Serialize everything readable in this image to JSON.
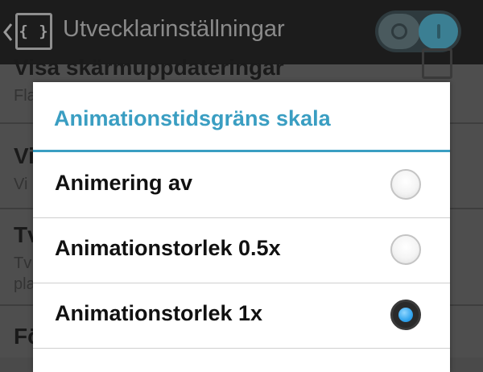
{
  "actionbar": {
    "icon_glyph": "{ }",
    "title": "Utvecklarinställningar",
    "toggle_state": "on"
  },
  "settings": {
    "items": [
      {
        "title": "Visa skärmuppdateringar",
        "summary": "Fla"
      },
      {
        "title": "Vi",
        "summary": "Vi"
      },
      {
        "title": "Tv",
        "summary_line1": "Tv",
        "summary_line2": "pla"
      },
      {
        "title": "Fö"
      }
    ]
  },
  "dialog": {
    "title": "Animationstidsgräns skala",
    "options": [
      {
        "label": "Animering av",
        "selected": false
      },
      {
        "label": "Animationstorlek 0.5x",
        "selected": false
      },
      {
        "label": "Animationstorlek 1x",
        "selected": true
      }
    ]
  },
  "colors": {
    "accent": "#3a9ec2",
    "actionbar_bg": "#1c1c1c",
    "radio_selected": "#33a5ee"
  },
  "icons": {
    "back": "chevron-left-icon",
    "app": "developer-braces-icon",
    "toggle": "master-switch-toggle"
  }
}
